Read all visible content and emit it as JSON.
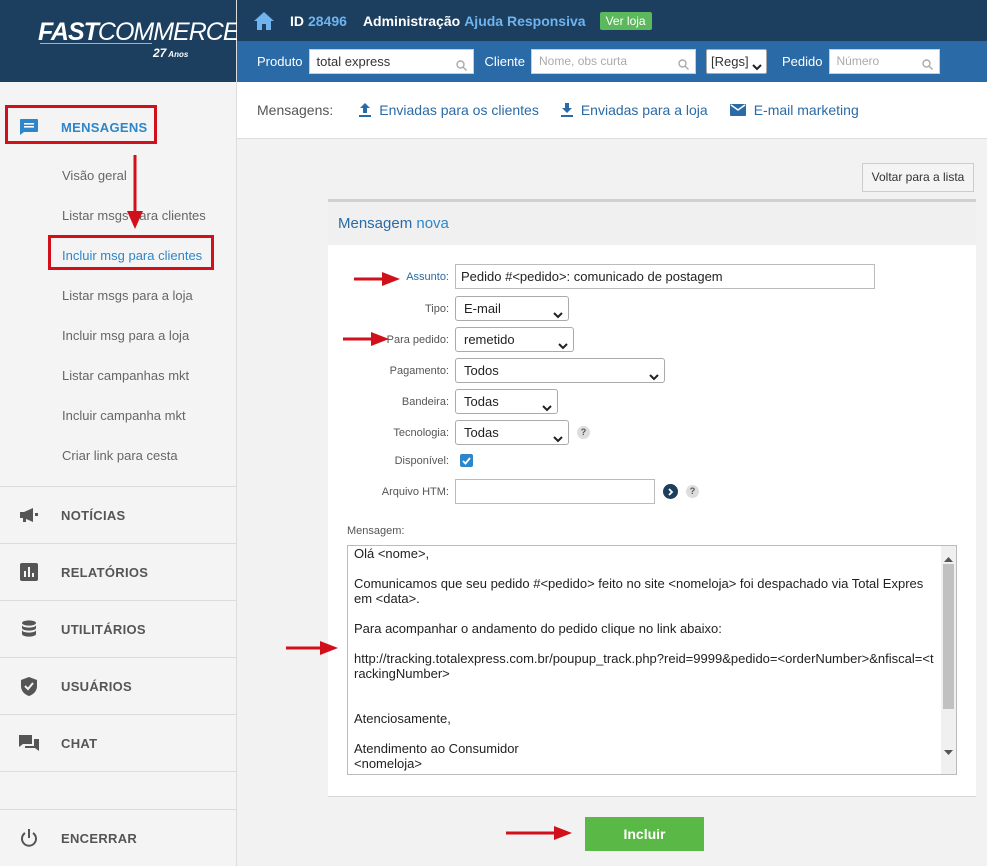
{
  "brand": {
    "name_bold": "FAST",
    "name_thin": "COMMERCE",
    "years": "27",
    "years_suffix": "Anos"
  },
  "topbar": {
    "id_label": "ID",
    "id_value": "28496",
    "admin": "Administração",
    "help": "Ajuda Responsiva",
    "ver_loja": "Ver loja"
  },
  "searchbar": {
    "produto_label": "Produto",
    "produto_value": "total express",
    "cliente_label": "Cliente",
    "cliente_placeholder": "Nome, obs curta",
    "regs_value": "[Regs]",
    "pedido_label": "Pedido",
    "pedido_placeholder": "Número"
  },
  "msgnav": {
    "label": "Mensagens:",
    "links": [
      "Enviadas para os clientes",
      "Enviadas para a loja",
      "E-mail marketing"
    ]
  },
  "sidebar": {
    "mensagens": "MENSAGENS",
    "sub": [
      "Visão geral",
      "Listar msgs para clientes",
      "Incluir msg para clientes",
      "Listar msgs para a loja",
      "Incluir msg para a loja",
      "Listar campanhas mkt",
      "Incluir campanha mkt",
      "Criar link para cesta"
    ],
    "sections": [
      "NOTÍCIAS",
      "RELATÓRIOS",
      "UTILITÁRIOS",
      "USUÁRIOS",
      "CHAT"
    ],
    "encerrar": "ENCERRAR"
  },
  "back_button": "Voltar para a lista",
  "panel": {
    "title": "Mensagem",
    "title_accent": "nova",
    "assunto_label": "Assunto:",
    "assunto_value": "Pedido #<pedido>: comunicado de postagem",
    "tipo_label": "Tipo:",
    "tipo_value": "E-mail",
    "para_pedido_label": "Para pedido:",
    "para_pedido_value": "remetido",
    "pagamento_label": "Pagamento:",
    "pagamento_value": "Todos",
    "bandeira_label": "Bandeira:",
    "bandeira_value": "Todas",
    "tecnologia_label": "Tecnologia:",
    "tecnologia_value": "Todas",
    "disponivel_label": "Disponível:",
    "arquivo_label": "Arquivo HTM:",
    "mensagem_label": "Mensagem:",
    "mensagem_lines": [
      "Olá <nome>,",
      "",
      "Comunicamos que seu pedido #<pedido> feito no site <nomeloja> foi despachado via Total Expres em <data>.",
      "",
      "Para acompanhar o andamento do pedido clique no link abaixo:",
      "",
      "http://tracking.totalexpress.com.br/poupup_track.php?reid=9999&pedido=<orderNumber>&nfiscal=<trackingNumber>",
      "",
      "",
      "Atenciosamente,",
      "",
      "Atendimento ao Consumidor",
      "<nomeloja>"
    ],
    "submit": "Incluir"
  },
  "colors": {
    "navy": "#1c3e5f",
    "blue": "#2a6aa6",
    "accent": "#2d86c9",
    "green": "#5ab946",
    "annotation_red": "#d0101a"
  }
}
